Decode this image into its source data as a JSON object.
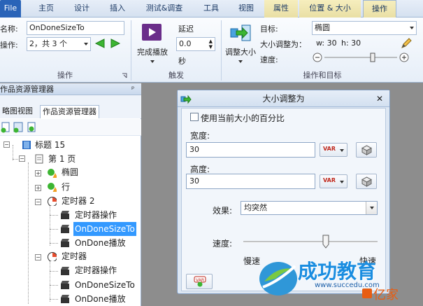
{
  "tabs": [
    "File",
    "主页",
    "设计",
    "插入",
    "测试&调查",
    "工具",
    "视图",
    "属性",
    "位置 & 大小",
    "操作"
  ],
  "ribbon": {
    "name_label": "名称:",
    "name_value": "OnDoneSizeTo",
    "action_label": "操作:",
    "action_value": "2，共 3 个",
    "done_play_label": "完成播放",
    "delay_label": "延迟",
    "delay_value": "0.0",
    "delay_unit": "秒",
    "resize_label": "调整大小",
    "target_label": "目标:",
    "target_value": "椭圆",
    "size_label": "大小调整为：",
    "size_w": "w: 30",
    "size_h": "h: 30",
    "speed_label": "速度:",
    "group_action": "操作",
    "group_trigger": "触发",
    "group_action_target": "操作和目标"
  },
  "panel": {
    "title": "作品资源管理器",
    "pin": "ᵖ",
    "tab_outline": "略图视图",
    "tab_explorer": "作品资源管理器"
  },
  "tree": [
    {
      "label": "标题 15",
      "depth": 0
    },
    {
      "label": "第 1 页",
      "depth": 1
    },
    {
      "label": "椭圆",
      "depth": 2
    },
    {
      "label": "行",
      "depth": 2
    },
    {
      "label": "定时器 2",
      "depth": 2
    },
    {
      "label": "定时器操作",
      "depth": 3
    },
    {
      "label": "OnDoneSizeTo",
      "depth": 3,
      "selected": true
    },
    {
      "label": "OnDone播放",
      "depth": 3
    },
    {
      "label": "定时器",
      "depth": 2
    },
    {
      "label": "定时器操作",
      "depth": 3
    },
    {
      "label": "OnDoneSizeTo",
      "depth": 3
    },
    {
      "label": "OnDone播放",
      "depth": 3
    }
  ],
  "dialog": {
    "title": "大小调整为",
    "close": "✕",
    "percent_checkbox": "使用当前大小的百分比",
    "width_label": "宽度:",
    "width_value": "30",
    "height_label": "高度:",
    "height_value": "30",
    "var_label": "VAR",
    "effect_label": "效果:",
    "effect_value": "均突然",
    "speed_label": "速度:",
    "slow": "慢速",
    "fast": "快速"
  },
  "watermark": {
    "brand": "成功教育",
    "url": "www.succedu.com",
    "corner": "亿家"
  },
  "colors": {
    "file_tab": "#2a64b8",
    "ribbon_bg": "#e6eef8",
    "selection": "#3399ff",
    "dialog_bg": "#dde7f3",
    "arrow_green": "#3cb532"
  }
}
